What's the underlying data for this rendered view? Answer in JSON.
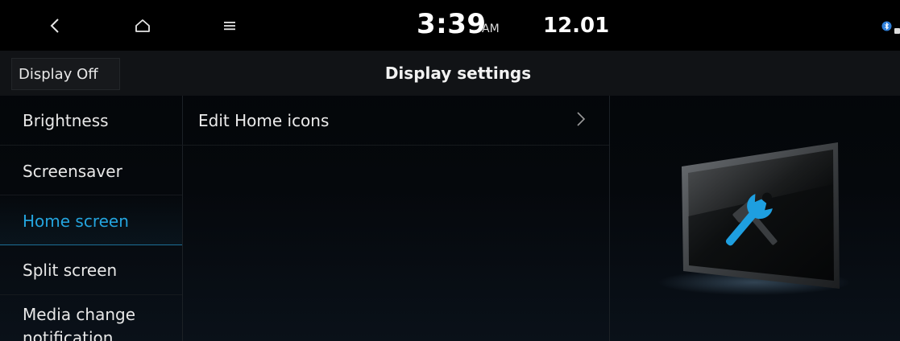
{
  "status_bar": {
    "time": "3:39",
    "ampm": "AM",
    "date": "12.01",
    "icons": [
      "back-icon",
      "home-icon",
      "menu-icon",
      "bluetooth-icon"
    ]
  },
  "header": {
    "display_off_label": "Display Off",
    "title": "Display settings"
  },
  "sidebar": {
    "items": [
      {
        "label": "Brightness",
        "active": false
      },
      {
        "label": "Screensaver",
        "active": false
      },
      {
        "label": "Home screen",
        "active": true
      },
      {
        "label": "Split screen",
        "active": false
      },
      {
        "label": "Media change notification",
        "active": false
      }
    ]
  },
  "content": {
    "items": [
      {
        "label": "Edit Home icons",
        "icon": "chevron-right-icon"
      }
    ]
  },
  "illustration": {
    "icon": "display-tools-icon"
  },
  "colors": {
    "accent": "#24a4de",
    "background": "#000000",
    "header": "#111316"
  }
}
